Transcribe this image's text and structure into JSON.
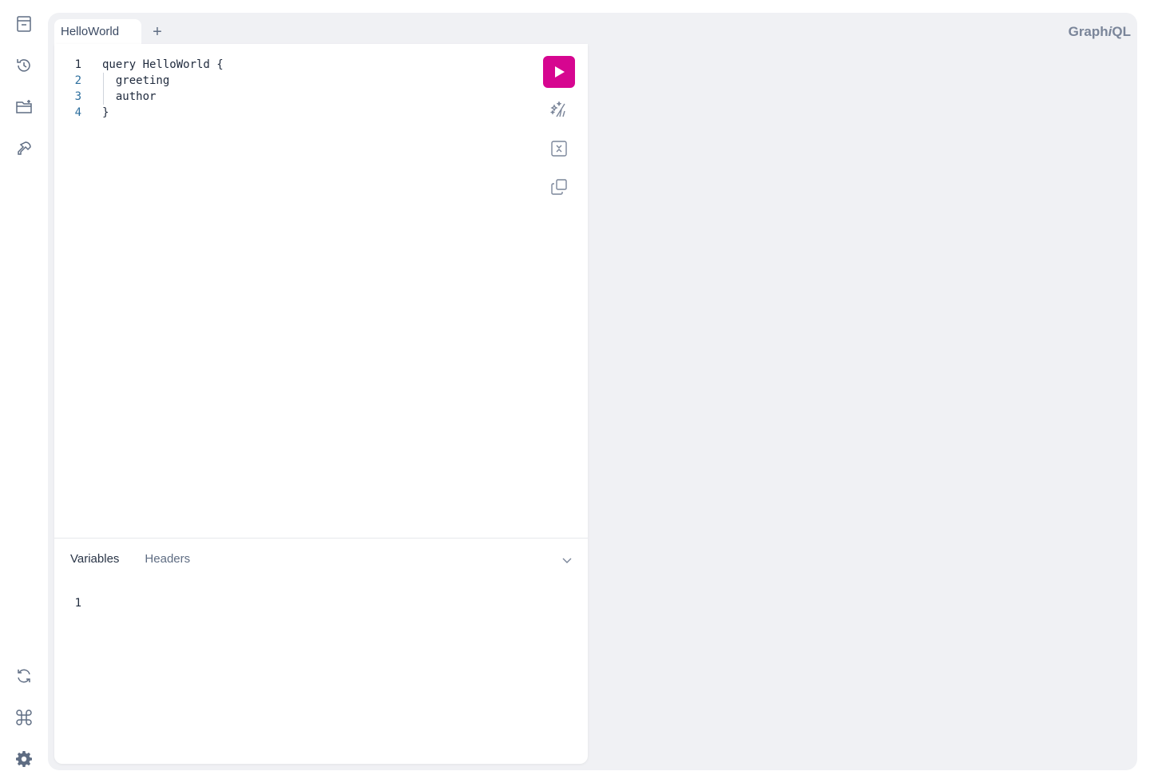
{
  "sidebar": {
    "top_items": [
      {
        "icon": "docs-icon",
        "label": "Documentation Explorer"
      },
      {
        "icon": "history-icon",
        "label": "History"
      },
      {
        "icon": "folder-icon",
        "label": "Collections"
      },
      {
        "icon": "key-icon",
        "label": "Auth"
      }
    ],
    "bottom_items": [
      {
        "icon": "refresh-icon",
        "label": "Re-fetch schema"
      },
      {
        "icon": "command-icon",
        "label": "Keyboard shortcuts"
      },
      {
        "icon": "gear-icon",
        "label": "Settings"
      }
    ]
  },
  "tabs": {
    "active": "HelloWorld",
    "add_label": "+"
  },
  "brand": {
    "prefix": "Graph",
    "italic": "i",
    "suffix": "QL"
  },
  "editor": {
    "lines": [
      {
        "num": "1",
        "text": "query HelloWorld {"
      },
      {
        "num": "2",
        "text": "  greeting"
      },
      {
        "num": "3",
        "text": "  author"
      },
      {
        "num": "4",
        "text": "}"
      }
    ],
    "toolbar": [
      "run-icon",
      "prettify-icon",
      "merge-icon",
      "copy-icon"
    ]
  },
  "variables": {
    "tab_variables": "Variables",
    "tab_headers": "Headers",
    "lines": [
      {
        "num": "1",
        "text": ""
      }
    ]
  },
  "colors": {
    "accent": "#d60690",
    "shell_bg": "#f0f1f4",
    "icon": "#5f6d83"
  }
}
